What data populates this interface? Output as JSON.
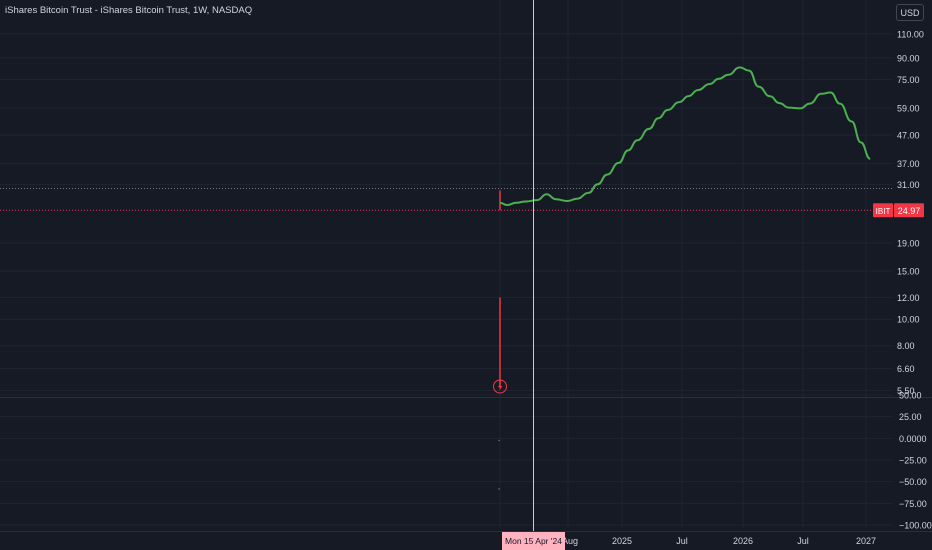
{
  "header": {
    "title": "iShares Bitcoin Trust - iShares Bitcoin Trust, 1W, NASDAQ"
  },
  "currency_button": "USD",
  "price_badge": {
    "symbol": "IBIT",
    "value": "24.97",
    "color": "#f23645"
  },
  "crosshair_date": "Mon 15 Apr '24",
  "colors": {
    "background": "#161a25",
    "grid": "#1f2433",
    "text": "#d1d4dc",
    "projection_line": "#4caf50",
    "bar": "#f23645",
    "crosshair": "#ffb3c1"
  },
  "chart_data": [
    {
      "type": "line",
      "title": "iShares Bitcoin Trust - iShares Bitcoin Trust, 1W, NASDAQ",
      "scale": "log",
      "y_ticks": [
        "110.00",
        "90.00",
        "75.00",
        "59.00",
        "47.00",
        "37.00",
        "31.00",
        "24.97",
        "19.00",
        "15.00",
        "12.00",
        "10.00",
        "8.00",
        "6.60",
        "5.50"
      ],
      "ylim": [
        5.2,
        130
      ],
      "x_ticks": [
        "Aug",
        "2025",
        "Jul",
        "2026",
        "Jul",
        "2027"
      ],
      "x": [
        "2024-01-15",
        "2024-02-05",
        "2024-03-04",
        "2024-04-01",
        "2024-05-06",
        "2024-06-03",
        "2024-07-01",
        "2024-08-05",
        "2024-09-02",
        "2024-10-07",
        "2024-11-04",
        "2024-12-02",
        "2025-01-06",
        "2025-02-03",
        "2025-03-03",
        "2025-04-07",
        "2025-05-05",
        "2025-06-02",
        "2025-07-07",
        "2025-08-04",
        "2025-09-01",
        "2025-10-06",
        "2025-11-03",
        "2025-12-01",
        "2026-01-05",
        "2026-02-02",
        "2026-03-02",
        "2026-04-06",
        "2026-05-04",
        "2026-06-01",
        "2026-07-06",
        "2026-08-03",
        "2026-09-07",
        "2026-10-05",
        "2026-11-02",
        "2026-12-07",
        "2027-01-04",
        "2027-02-01"
      ],
      "series": [
        {
          "values": [
            26.6,
            26.1,
            26.6,
            26.9,
            27.2,
            28.6,
            27.4,
            27.0,
            27.5,
            28.9,
            31.1,
            33.7,
            37.2,
            41.3,
            45.0,
            49.5,
            54.1,
            58.0,
            62.0,
            65.2,
            68.6,
            72.1,
            75.4,
            78.0,
            83.0,
            80.8,
            70.6,
            65.1,
            61.5,
            59.2,
            58.8,
            61.2,
            66.5,
            67.2,
            61.2,
            52.7,
            44.2,
            38.5
          ]
        }
      ],
      "bars": [
        {
          "x": "2024-01-15",
          "low": 24.97,
          "high": 29.5
        },
        {
          "x": "2024-01-15",
          "low": 5.6,
          "high": 12.0
        }
      ],
      "price_line": 24.97
    },
    {
      "type": "line",
      "y_ticks": [
        "50.00",
        "25.00",
        "0.0000",
        "−25.00",
        "−50.00",
        "−75.00",
        "−100.00"
      ],
      "ylim": [
        -100,
        50
      ],
      "series": []
    }
  ]
}
